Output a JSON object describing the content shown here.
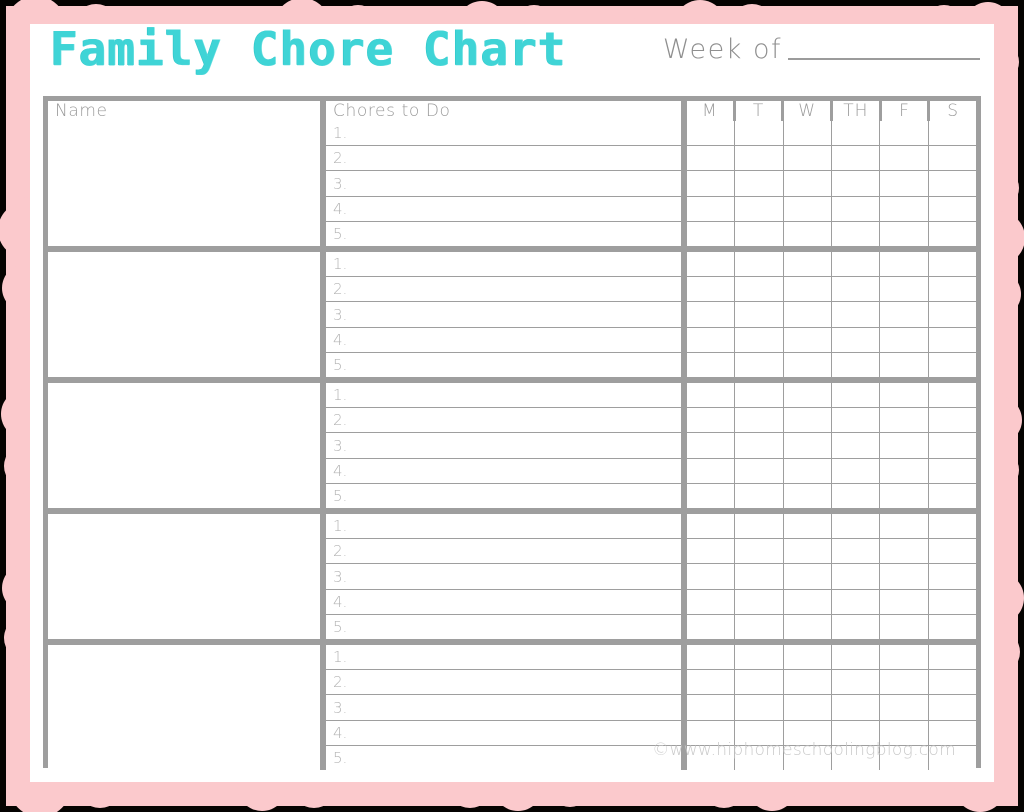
{
  "document": {
    "title": "Family Chore Chart",
    "credit": "©www.hiphomeschoolingblog.com"
  },
  "colors": {
    "title_turquoise": "#3FD4D6",
    "border_pink": "#FBC9CC",
    "table_gray": "#9E9E9E",
    "text_gray": "#9a9a9a",
    "page_white": "#FFFFFF",
    "backdrop_black": "#050301"
  },
  "header": {
    "title": "Family Chore Chart",
    "week_of_label": "Week of",
    "week_of_value": ""
  },
  "table": {
    "columns": {
      "name": "Name",
      "chores": "Chores to Do"
    },
    "day_headers": [
      "M",
      "T",
      "W",
      "TH",
      "F",
      "S"
    ],
    "chore_numbers": [
      "1.",
      "2.",
      "3.",
      "4.",
      "5."
    ],
    "rows": [
      {
        "name": "",
        "chores": [
          "",
          "",
          "",
          "",
          ""
        ]
      },
      {
        "name": "",
        "chores": [
          "",
          "",
          "",
          "",
          ""
        ]
      },
      {
        "name": "",
        "chores": [
          "",
          "",
          "",
          "",
          ""
        ]
      },
      {
        "name": "",
        "chores": [
          "",
          "",
          "",
          "",
          ""
        ]
      },
      {
        "name": "",
        "chores": [
          "",
          "",
          "",
          "",
          ""
        ]
      }
    ]
  }
}
